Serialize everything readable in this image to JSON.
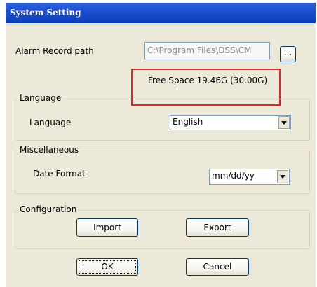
{
  "window": {
    "title": "System Setting"
  },
  "alarm": {
    "label": "Alarm Record path",
    "path_value": "C:\\Program Files\\DSS\\CM",
    "browse_label": "...",
    "free_space": "Free Space 19.46G (30.00G)"
  },
  "language": {
    "group_title": "Language",
    "label": "Language",
    "selected": "English"
  },
  "misc": {
    "group_title": "Miscellaneous",
    "date_label": "Date Format",
    "date_selected": "mm/dd/yy"
  },
  "config": {
    "group_title": "Configuration",
    "import_label": "Import",
    "export_label": "Export"
  },
  "footer": {
    "ok_label": "OK",
    "cancel_label": "Cancel"
  },
  "colors": {
    "highlight": "#e3262c",
    "titlebar": "#0a3fb8",
    "dialog_bg": "#ece9d8"
  }
}
